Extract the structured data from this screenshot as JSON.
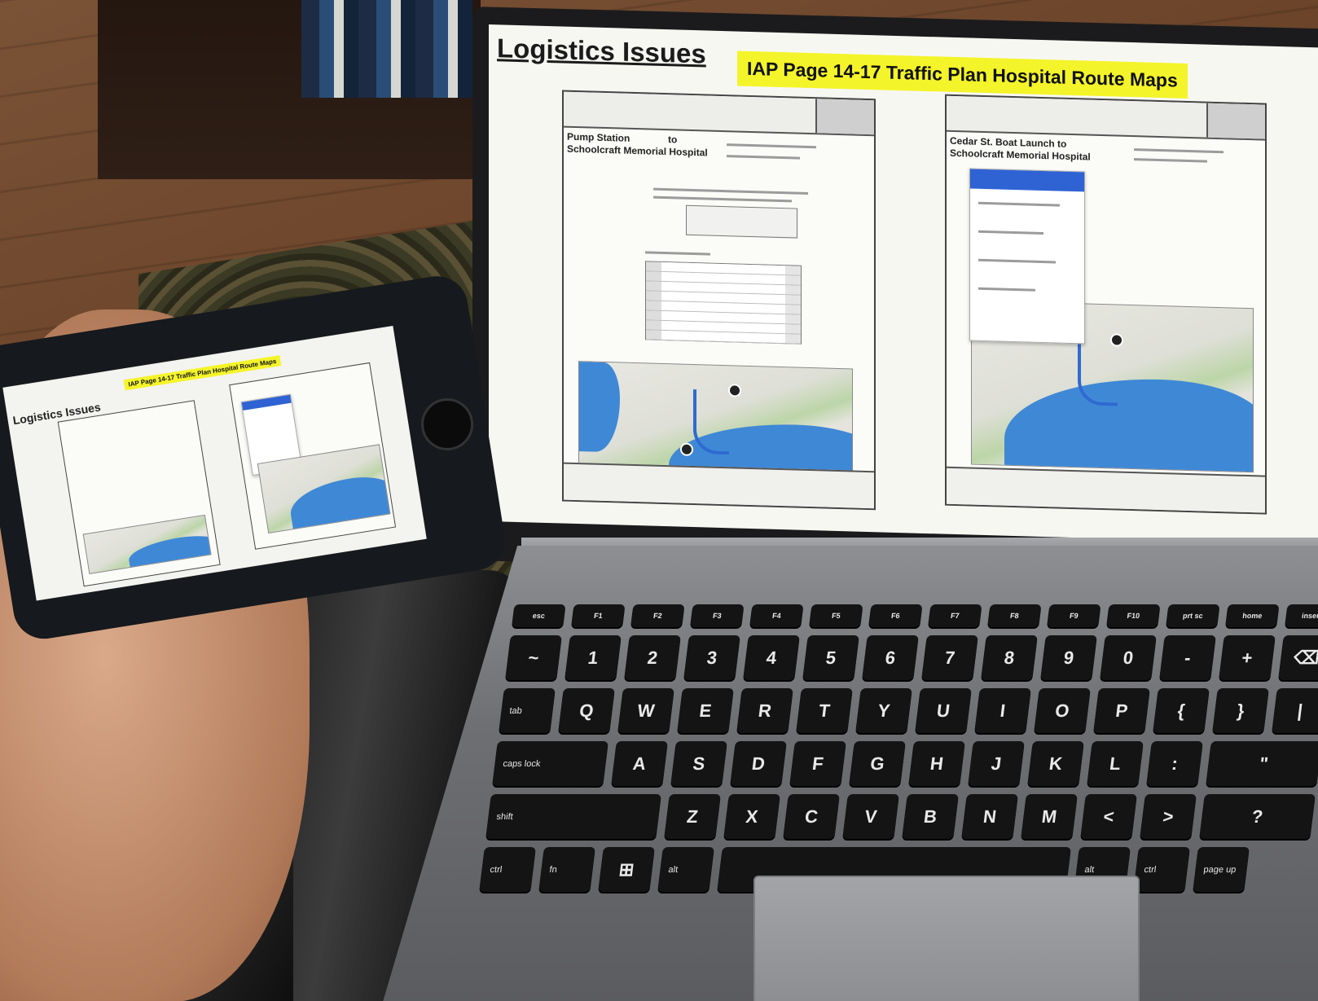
{
  "slide": {
    "title": "Logistics Issues",
    "banner": "IAP Page 14-17 Traffic Plan Hospital Route Maps"
  },
  "doc_left": {
    "title_line1": "Pump Station",
    "title_to": "to",
    "title_line2": "Schoolcraft Memorial Hospital"
  },
  "doc_right": {
    "title_line1": "Cedar St. Boat Launch to",
    "title_line2": "Schoolcraft Memorial Hospital"
  },
  "phone": {
    "title": "Logistics Issues",
    "banner": "IAP Page 14-17 Traffic Plan Hospital Route Maps"
  },
  "keyboard": {
    "row_numbers": [
      "~",
      "1",
      "2",
      "3",
      "4",
      "5",
      "6",
      "7",
      "8",
      "9",
      "0",
      "-",
      "+",
      "⌫"
    ],
    "row_qwerty": [
      "tab",
      "Q",
      "W",
      "E",
      "R",
      "T",
      "Y",
      "U",
      "I",
      "O",
      "P",
      "{",
      "}",
      "|"
    ],
    "row_home": [
      "caps lock",
      "A",
      "S",
      "D",
      "F",
      "G",
      "H",
      "J",
      "K",
      "L",
      ":",
      "\""
    ],
    "row_shift": [
      "shift",
      "Z",
      "X",
      "C",
      "V",
      "B",
      "N",
      "M",
      "<",
      ">",
      "?"
    ],
    "row_bottom": [
      "ctrl",
      "fn",
      "win",
      "alt",
      "space",
      "alt",
      "ctrl",
      "page up"
    ]
  },
  "colors": {
    "banner_yellow": "#f4f42a",
    "map_sea": "#3f88d6",
    "route_blue": "#2f6ad0",
    "popup_header": "#2f63d4"
  }
}
